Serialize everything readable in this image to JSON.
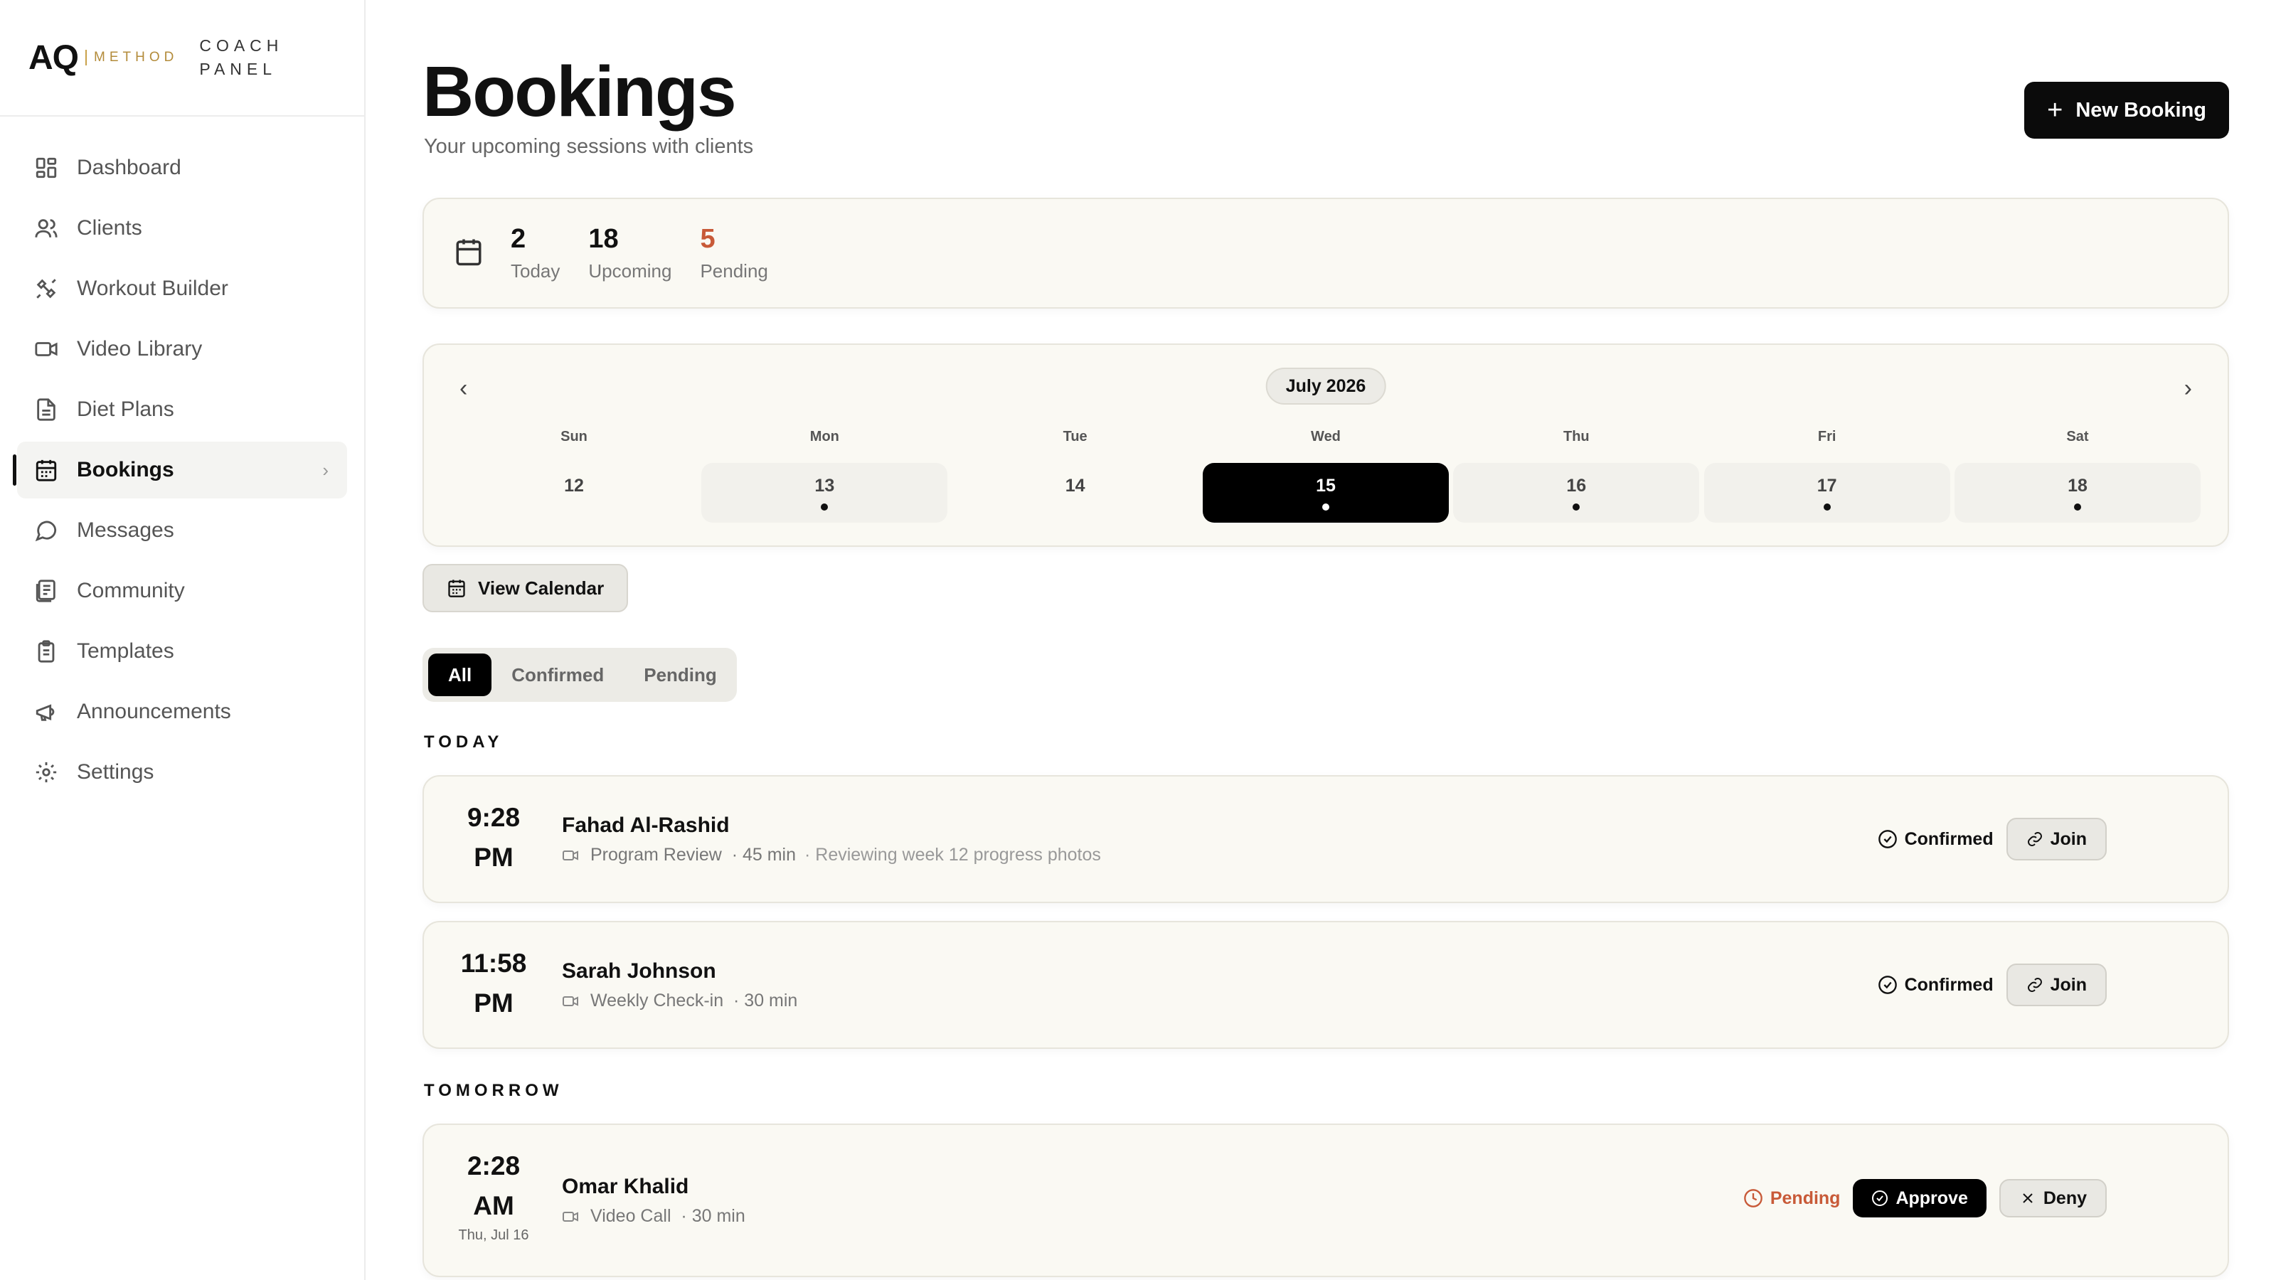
{
  "brand": {
    "logo": "AQ",
    "method": "METHOD",
    "panel_line1": "COACH",
    "panel_line2": "PANEL"
  },
  "sidebar": {
    "items": [
      {
        "label": "Dashboard",
        "icon": "dashboard-icon"
      },
      {
        "label": "Clients",
        "icon": "users-icon"
      },
      {
        "label": "Workout Builder",
        "icon": "workout-icon"
      },
      {
        "label": "Video Library",
        "icon": "video-icon"
      },
      {
        "label": "Diet Plans",
        "icon": "document-icon"
      },
      {
        "label": "Bookings",
        "icon": "calendar-icon",
        "active": true
      },
      {
        "label": "Messages",
        "icon": "message-icon"
      },
      {
        "label": "Community",
        "icon": "community-icon"
      },
      {
        "label": "Templates",
        "icon": "clipboard-icon"
      },
      {
        "label": "Announcements",
        "icon": "megaphone-icon"
      },
      {
        "label": "Settings",
        "icon": "gear-icon"
      }
    ]
  },
  "header": {
    "title": "Bookings",
    "subtitle": "Your upcoming sessions with clients",
    "new_booking_label": "New Booking"
  },
  "stats": {
    "today": {
      "value": "2",
      "label": "Today"
    },
    "upcoming": {
      "value": "18",
      "label": "Upcoming"
    },
    "pending": {
      "value": "5",
      "label": "Pending"
    }
  },
  "week": {
    "month": "July 2026",
    "days": [
      {
        "name": "Sun",
        "num": "12",
        "has": false,
        "selected": false
      },
      {
        "name": "Mon",
        "num": "13",
        "has": true,
        "selected": false
      },
      {
        "name": "Tue",
        "num": "14",
        "has": false,
        "selected": false
      },
      {
        "name": "Wed",
        "num": "15",
        "has": true,
        "selected": true
      },
      {
        "name": "Thu",
        "num": "16",
        "has": true,
        "selected": false
      },
      {
        "name": "Fri",
        "num": "17",
        "has": true,
        "selected": false
      },
      {
        "name": "Sat",
        "num": "18",
        "has": true,
        "selected": false
      }
    ]
  },
  "view_calendar_label": "View Calendar",
  "filters": {
    "all": "All",
    "confirmed": "Confirmed",
    "pending": "Pending"
  },
  "sections": {
    "today": "TODAY",
    "tomorrow": "TOMORROW"
  },
  "bookings": [
    {
      "time": "9:28",
      "ampm": "PM",
      "date": "",
      "name": "Fahad Al-Rashid",
      "type": "Program Review",
      "duration": "· 45 min",
      "note": "· Reviewing week 12 progress photos",
      "status": "Confirmed",
      "join": "Join"
    },
    {
      "time": "11:58",
      "ampm": "PM",
      "date": "",
      "name": "Sarah Johnson",
      "type": "Weekly Check-in",
      "duration": "· 30 min",
      "note": "",
      "status": "Confirmed",
      "join": "Join"
    },
    {
      "time": "2:28",
      "ampm": "AM",
      "date": "Thu, Jul 16",
      "name": "Omar Khalid",
      "type": "Video Call",
      "duration": "· 30 min",
      "note": "",
      "status": "Pending",
      "approve": "Approve",
      "deny": "Deny"
    }
  ],
  "colors": {
    "pending": "#c85a38",
    "accent": "#000000",
    "card_bg": "#faf9f3",
    "brand_gold": "#b38b3a"
  }
}
